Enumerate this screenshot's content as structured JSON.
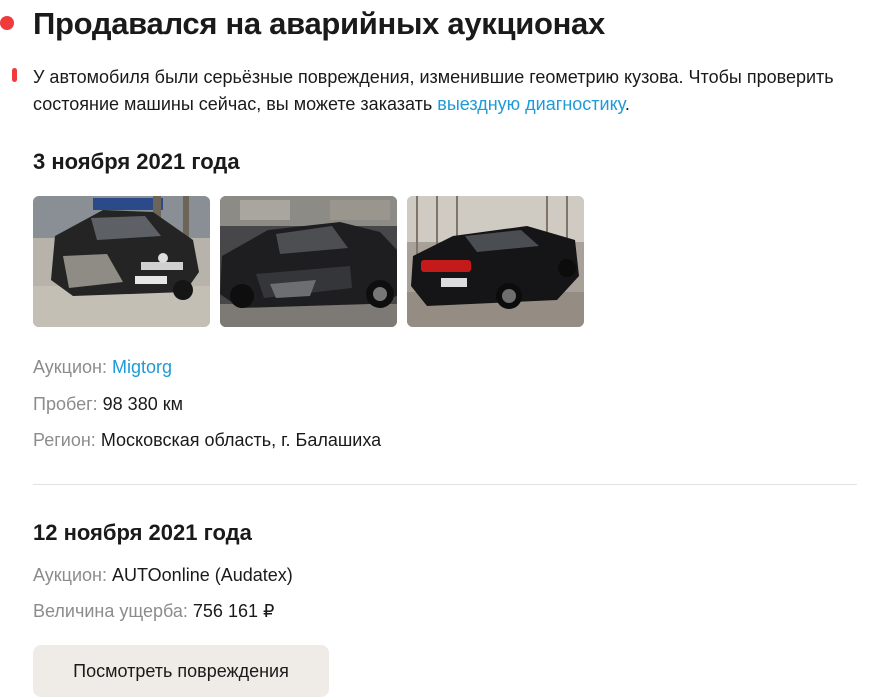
{
  "header": {
    "title": "Продавался на аварийных аукционах",
    "dot_color": "#ef3b3b"
  },
  "warning": {
    "text": "У автомобиля были серьёзные повреждения, изменившие геометрию кузова. Чтобы проверить состояние машины сейчас, вы можете заказать ",
    "link_text": "выездную диагностику",
    "end": "."
  },
  "records": [
    {
      "date": "3 ноября 2021 года",
      "photos": [
        {
          "alt": "damaged-car-front"
        },
        {
          "alt": "damaged-car-side"
        },
        {
          "alt": "damaged-car-rear"
        }
      ],
      "auction_label": "Аукцион: ",
      "auction_value": "Migtorg",
      "mileage_label": "Пробег: ",
      "mileage_value": "98 380 км",
      "region_label": "Регион: ",
      "region_value": "Московская область, г. Балашиха"
    },
    {
      "date": "12 ноября 2021 года",
      "auction_label": "Аукцион: ",
      "auction_value": "AUTOonline (Audatex)",
      "damage_label": "Величина ущерба: ",
      "damage_value": "756 161 ₽",
      "button_label": "Посмотреть повреждения"
    }
  ],
  "colors": {
    "accent_red": "#ef3b3b",
    "link_blue": "#1e9ad6",
    "label_gray": "#8c8c8c",
    "button_bg": "#efece7"
  }
}
